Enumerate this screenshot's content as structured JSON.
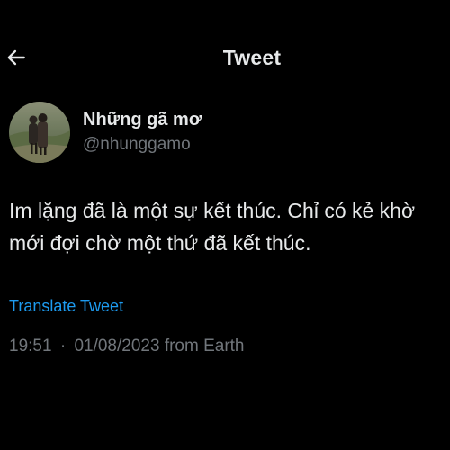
{
  "header": {
    "title": "Tweet",
    "back_icon": "arrow-left-icon"
  },
  "author": {
    "display_name": "Những gã mơ",
    "handle": "@nhunggamo",
    "avatar": "couple-photo-avatar"
  },
  "tweet": {
    "text_lines": [
      "Im lặng đã là một sự kết thúc. Chỉ có kẻ khờ",
      "mới đợi chờ một thứ đã kết thúc."
    ],
    "translate_label": "Translate Tweet",
    "time": "19:51",
    "separator": "·",
    "date": "01/08/2023",
    "source": "from Earth"
  },
  "colors": {
    "background": "#000000",
    "text": "#e7e9ea",
    "secondary": "#71767b",
    "link": "#1d9bf0"
  }
}
